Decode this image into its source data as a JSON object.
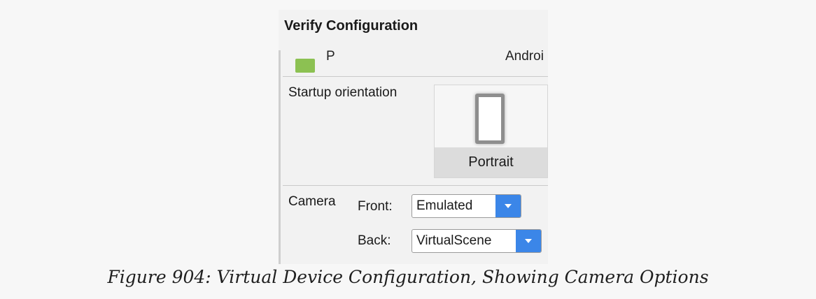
{
  "dialog": {
    "title": "Verify Configuration",
    "prev_row": {
      "letter": "P",
      "text": "Androi"
    },
    "orientation": {
      "label": "Startup orientation",
      "option": "Portrait"
    },
    "camera": {
      "label": "Camera",
      "front": {
        "label": "Front:",
        "value": "Emulated"
      },
      "back": {
        "label": "Back:",
        "value": "VirtualScene"
      }
    }
  },
  "figure_caption": "Figure 904: Virtual Device Configuration, Showing Camera Options",
  "colors": {
    "accent": "#3b86e8",
    "swatch": "#8cc152"
  },
  "icons": [
    "portrait-orientation-icon",
    "dropdown-arrow-icon"
  ]
}
